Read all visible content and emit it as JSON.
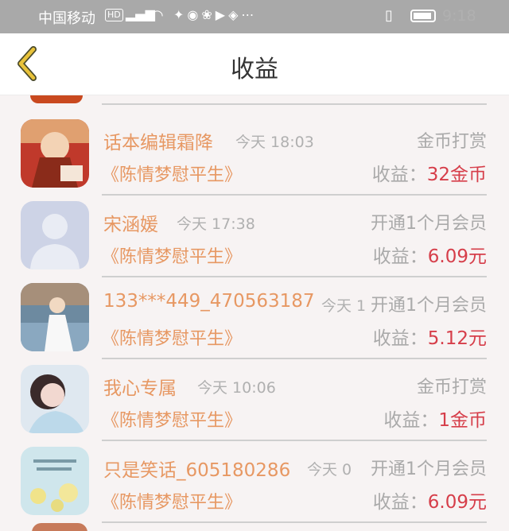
{
  "status_bar": {
    "carrier": "中国移动",
    "hd": "HD",
    "network": "4G",
    "time": "9:18"
  },
  "header": {
    "title": "收益"
  },
  "records": [
    {
      "name": "话本编辑霜降",
      "time": "今天 18:03",
      "type": "金币打赏",
      "book": "《陈情梦慰平生》",
      "earn_label": "收益：",
      "earn_value": "32金币"
    },
    {
      "name": "宋涵媛",
      "time": "今天 17:38",
      "type": "开通1个月会员",
      "book": "《陈情梦慰平生》",
      "earn_label": "收益：",
      "earn_value": "6.09元"
    },
    {
      "name": "133***449_470563187",
      "time": "今天 1",
      "type": "开通1个月会员",
      "book": "《陈情梦慰平生》",
      "earn_label": "收益：",
      "earn_value": "5.12元"
    },
    {
      "name": "我心专属",
      "time": "今天 10:06",
      "type": "金币打赏",
      "book": "《陈情梦慰平生》",
      "earn_label": "收益：",
      "earn_value": "1金币"
    },
    {
      "name": "只是笑话_605180286",
      "time": "今天 0",
      "type": "开通1个月会员",
      "book": "《陈情梦慰平生》",
      "earn_label": "收益：",
      "earn_value": "6.09元"
    }
  ],
  "colors": {
    "accent_name": "#e79863",
    "earn_value": "#d63e4a",
    "muted": "#aaaaaa",
    "back_arrow": "#e8c23a"
  }
}
